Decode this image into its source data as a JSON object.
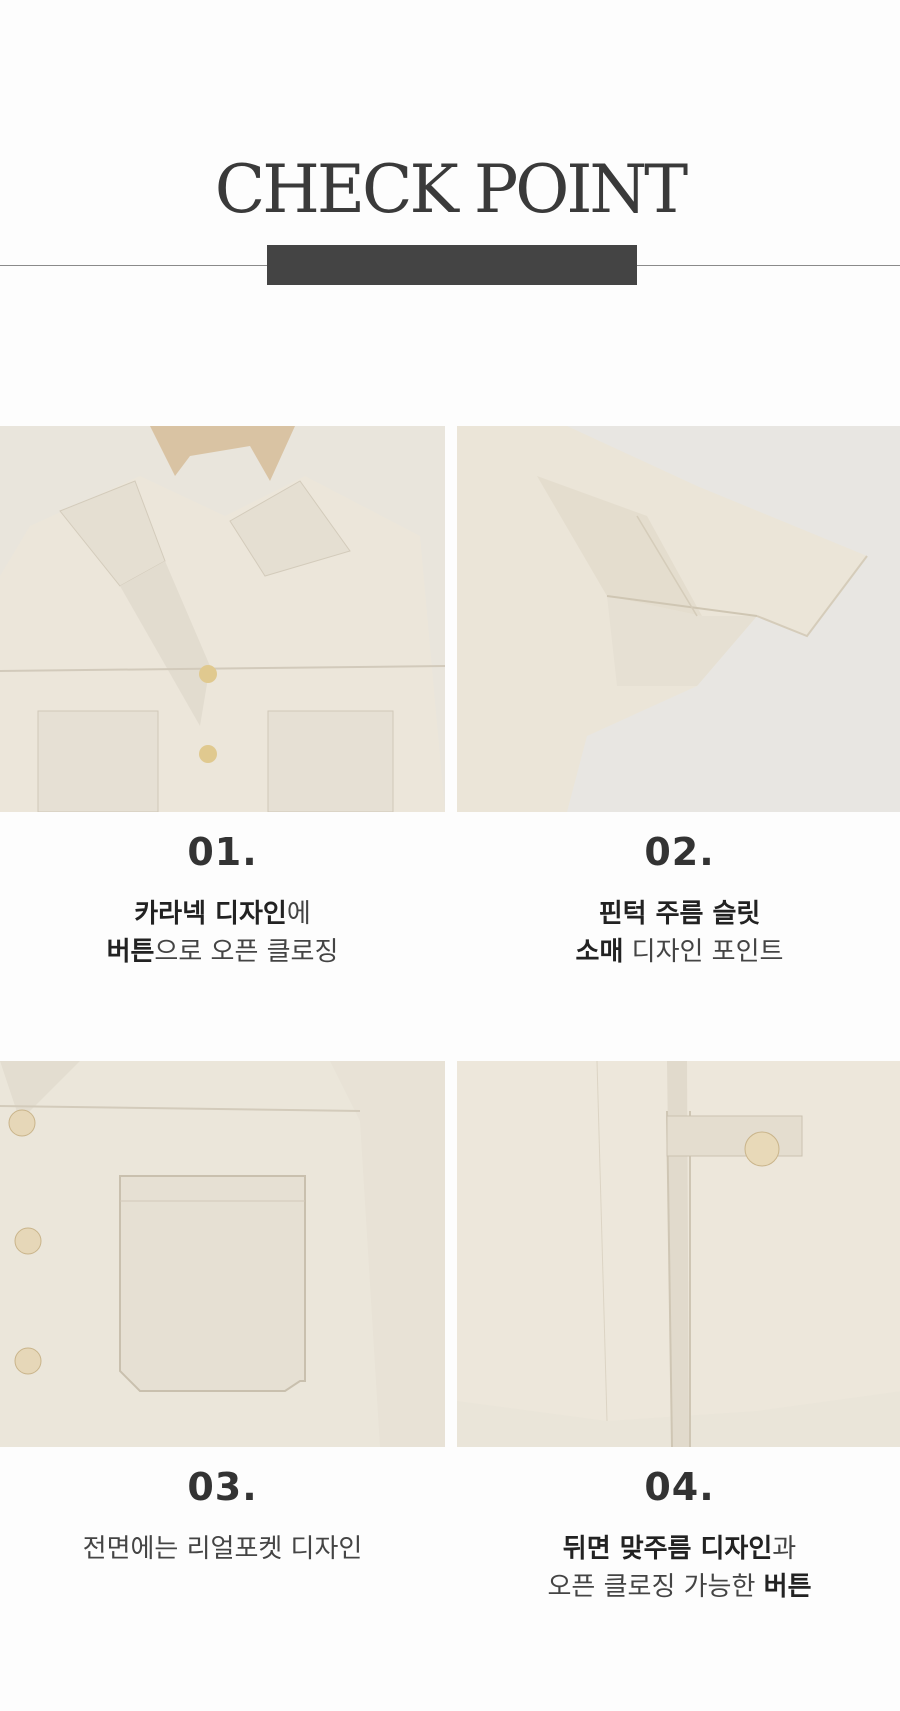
{
  "header": {
    "title": "CHECK POINT"
  },
  "points": [
    {
      "number": "01.",
      "line1_bold": "카라넥 디자인",
      "line1_rest": "에",
      "line2_bold": "버튼",
      "line2_rest": "으로 오픈 클로징"
    },
    {
      "number": "02.",
      "line1_bold": "핀턱 주름 슬릿",
      "line1_rest": "",
      "line2_bold": "소매",
      "line2_rest": " 디자인 포인트"
    },
    {
      "number": "03.",
      "line1_plain": "전면에는 리얼포켓 디자인"
    },
    {
      "number": "04.",
      "line1_bold": "뒤면 맞주름 디자인",
      "line1_rest": "과",
      "line2_pre": "오픈 클로징 가능한 ",
      "line2_bold": "버튼"
    }
  ],
  "colors": {
    "fabric": "#ece7dc",
    "background": "#fdfdfd",
    "bar": "#444444"
  }
}
